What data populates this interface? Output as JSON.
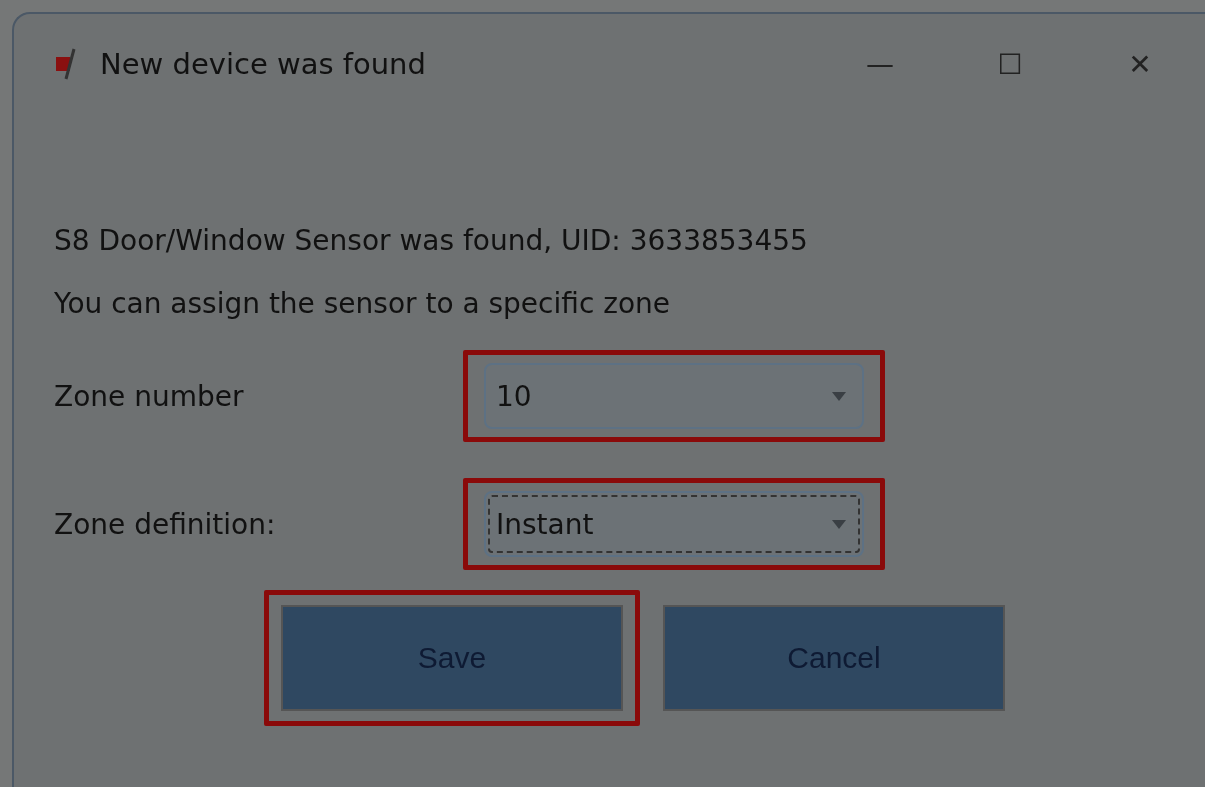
{
  "window": {
    "title": "New device was found",
    "controls": [
      "—",
      "☐",
      "✕"
    ]
  },
  "message": "S8 Door/Window Sensor was found, UID: 3633853455",
  "hint": "You can assign the sensor to a specific zone",
  "fields": [
    {
      "label": "Zone number",
      "value": "10",
      "focused": false,
      "highlighted": true
    },
    {
      "label": "Zone definition:",
      "value": "Instant",
      "focused": true,
      "highlighted": true
    }
  ],
  "buttons": [
    {
      "label": "Save",
      "highlighted": true
    },
    {
      "label": "Cancel",
      "highlighted": false
    }
  ]
}
